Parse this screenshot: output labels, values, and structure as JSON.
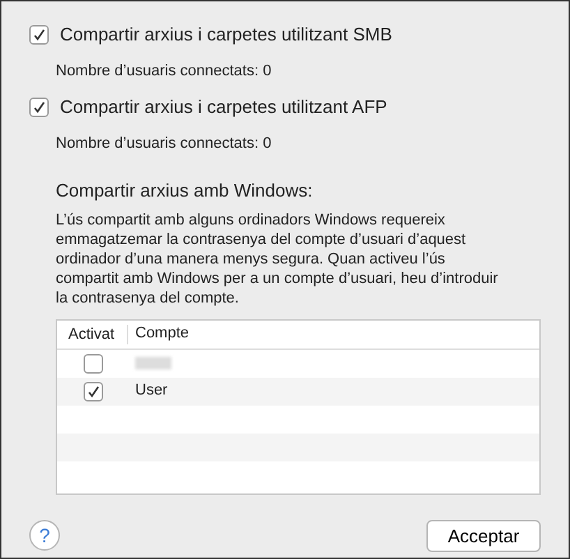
{
  "options": [
    {
      "label": "Compartir arxius i carpetes utilitzant SMB",
      "checked": true,
      "status": "Nombre d’usuaris connectats: 0"
    },
    {
      "label": "Compartir arxius i carpetes utilitzant AFP",
      "checked": true,
      "status": "Nombre d’usuaris connectats: 0"
    }
  ],
  "windows_section": {
    "title": "Compartir arxius amb Windows:",
    "description": "L’ús compartit amb alguns ordinadors Windows requereix emmagatzemar la contrasenya del compte d’usuari d’aquest ordinador d’una manera menys segura. Quan activeu l’ús compartit amb Windows per a un compte d’usuari, heu d’introduir la contrasenya del compte."
  },
  "table": {
    "columns": [
      "Activat",
      "Compte"
    ],
    "rows": [
      {
        "enabled": false,
        "kind": "redacted"
      },
      {
        "enabled": true,
        "kind": "account",
        "account": "User"
      }
    ]
  },
  "buttons": {
    "help": "?",
    "ok": "Acceptar"
  }
}
